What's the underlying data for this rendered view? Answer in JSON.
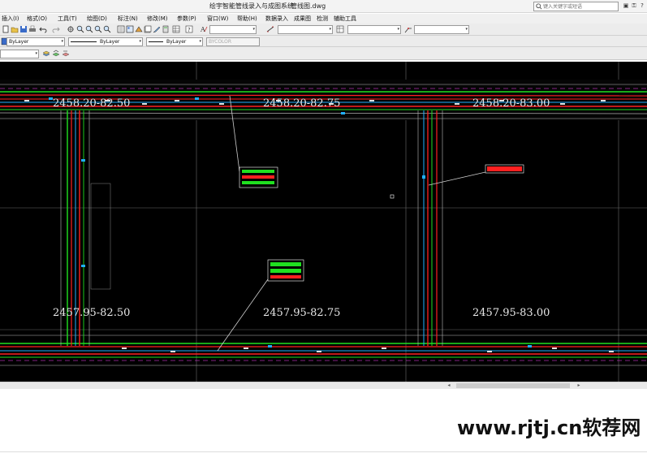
{
  "window": {
    "app_title": "绘宇智能管线录入与成图系统",
    "file_name": "管线图.dwg",
    "search_placeholder": "键入关键字或短语"
  },
  "menu": {
    "items": [
      "插入(I)",
      "格式(O)",
      "工具(T)",
      "绘图(D)",
      "标注(N)",
      "修改(M)",
      "参数(P)",
      "窗口(W)",
      "帮助(H)",
      "数据录入",
      "成果图",
      "检测",
      "辅助工具"
    ]
  },
  "properties": {
    "layer": "ByLayer",
    "linetype": "ByLayer",
    "lineweight": "ByLayer",
    "plot_style": "BYCOLOR"
  },
  "drawing": {
    "grid_labels": [
      "2458.20-82.50",
      "2458.20-82.75",
      "2458.20-83.00",
      "2457.95-82.50",
      "2457.95-82.75",
      "2457.95-83.00"
    ]
  },
  "watermark": "www.rjtj.cn软荐网",
  "colors": {
    "canvas": "#000000",
    "pipe_red": "#ff2020",
    "pipe_green": "#20e020",
    "pipe_cyan": "#20b0ff",
    "label_white": "#e8e8e8"
  }
}
